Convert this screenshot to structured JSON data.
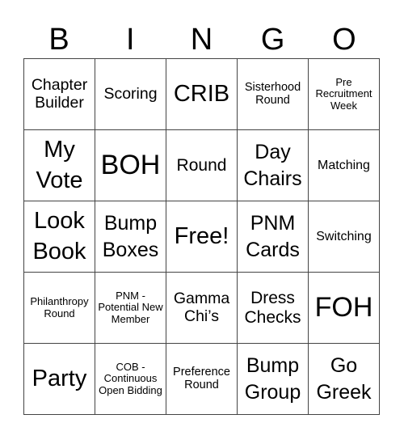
{
  "header": {
    "letters": [
      "B",
      "I",
      "N",
      "G",
      "O"
    ]
  },
  "board": {
    "rows": [
      [
        {
          "text": "Chapter Builder",
          "size": "s19"
        },
        {
          "text": "Scoring",
          "size": "s19"
        },
        {
          "text": "CRIB",
          "size": "s29"
        },
        {
          "text": "Sisterhood Round",
          "size": "s14"
        },
        {
          "text": "Pre Recruitment Week",
          "size": "s13"
        }
      ],
      [
        {
          "text": "My Vote",
          "size": "s29"
        },
        {
          "text": "BOH",
          "size": "s34"
        },
        {
          "text": "Round",
          "size": "s21"
        },
        {
          "text": "Day Chairs",
          "size": "s25"
        },
        {
          "text": "Matching",
          "size": "s16"
        }
      ],
      [
        {
          "text": "Look Book",
          "size": "s29"
        },
        {
          "text": "Bump Boxes",
          "size": "s25"
        },
        {
          "text": "Free!",
          "size": "s29"
        },
        {
          "text": "PNM Cards",
          "size": "s25"
        },
        {
          "text": "Switching",
          "size": "s16"
        }
      ],
      [
        {
          "text": "Philanthropy Round",
          "size": "s13"
        },
        {
          "text": "PNM - Potential New Member",
          "size": "s13"
        },
        {
          "text": "Gamma Chi’s",
          "size": "s19"
        },
        {
          "text": "Dress Checks",
          "size": "s21"
        },
        {
          "text": "FOH",
          "size": "s34"
        }
      ],
      [
        {
          "text": "Party",
          "size": "s29"
        },
        {
          "text": "COB - Continuous Open Bidding",
          "size": "s13"
        },
        {
          "text": "Preference Round",
          "size": "s14"
        },
        {
          "text": "Bump Group",
          "size": "s25"
        },
        {
          "text": "Go Greek",
          "size": "s25"
        }
      ]
    ]
  }
}
